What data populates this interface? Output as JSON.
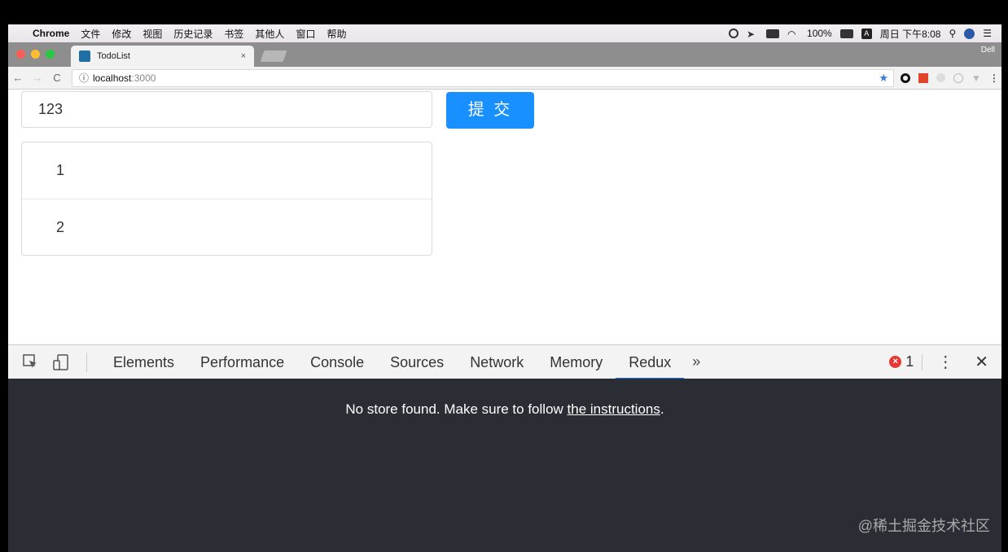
{
  "menubar": {
    "apple": "",
    "app_name": "Chrome",
    "items": [
      "文件",
      "修改",
      "视图",
      "历史记录",
      "书签",
      "其他人",
      "窗口",
      "帮助"
    ],
    "battery": "100%",
    "input_method": "A",
    "clock": "周日 下午8:08"
  },
  "tab": {
    "title": "TodoList",
    "close": "×",
    "profile": "Dell"
  },
  "toolbar": {
    "back": "←",
    "forward": "→",
    "reload": "C",
    "info": "ⓘ",
    "host": "localhost",
    "port": ":3000",
    "star": "★"
  },
  "page": {
    "input_value": "123",
    "submit_label": "提 交",
    "items": [
      "1",
      "2"
    ]
  },
  "devtools": {
    "tabs": [
      "Elements",
      "Performance",
      "Console",
      "Sources",
      "Network",
      "Memory",
      "Redux"
    ],
    "active_tab": "Redux",
    "more": "»",
    "error_icon": "×",
    "error_count": "1",
    "kebab": "⋮",
    "close": "✕",
    "message_before": "No store found. Make sure to follow ",
    "message_link": "the instructions",
    "message_after": ".",
    "watermark": "@稀土掘金技术社区"
  }
}
